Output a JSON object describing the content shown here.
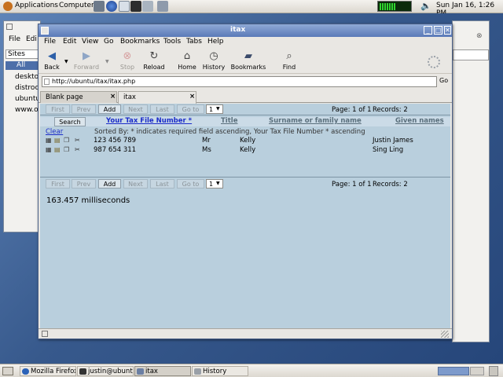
{
  "top_panel": {
    "applications": "Applications",
    "computer": "Computer",
    "clock": "Sun Jan 16,  1:26 PM"
  },
  "bg_window": {
    "menu_file": "File",
    "menu_edit": "Edi",
    "sites": "Sites",
    "all": "All",
    "items": [
      "deskto",
      "distroc",
      "ubuntu",
      "www.os"
    ]
  },
  "window": {
    "title": "itax",
    "menu": [
      "File",
      "Edit",
      "View",
      "Go",
      "Bookmarks",
      "Tools",
      "Tabs",
      "Help"
    ],
    "toolbar": {
      "back": "Back",
      "forward": "Forward",
      "stop": "Stop",
      "reload": "Reload",
      "home": "Home",
      "history": "History",
      "bookmarks": "Bookmarks",
      "find": "Find"
    },
    "url": "http://ubuntu/itax/itax.php",
    "go": "Go",
    "tabs": [
      {
        "label": "Blank page",
        "close": "×"
      },
      {
        "label": "itax",
        "close": "×"
      }
    ]
  },
  "page": {
    "nav": {
      "first": "First",
      "prev": "Prev",
      "add": "Add",
      "next": "Next",
      "last": "Last",
      "goto": "Go to",
      "page_select": "1",
      "page_info": "Page:  1 of 1",
      "records": "Records:  2"
    },
    "search": "Search",
    "columns": [
      "Your Tax File Number *",
      "Title",
      "Surname or family name",
      "Given names"
    ],
    "clear": "Clear",
    "sorted_by": "Sorted By: * indicates required field ascending, Your Tax File Number * ascending",
    "rows": [
      {
        "tfn": "123 456 789",
        "title": "Mr",
        "surname": "Kelly",
        "given": "Justin James"
      },
      {
        "tfn": "987 654 311",
        "title": "Ms",
        "surname": "Kelly",
        "given": "Sing Ling"
      }
    ],
    "timing": "163.457 milliseconds"
  },
  "taskbar": [
    {
      "label": "Mozilla Firefox"
    },
    {
      "label": "justin@ubuntu"
    },
    {
      "label": "itax"
    },
    {
      "label": "History"
    }
  ],
  "colors": {
    "content_bg": "#b9cfdd",
    "title_bar": "#5a79b8",
    "primary_header": "#1b2cc9"
  }
}
